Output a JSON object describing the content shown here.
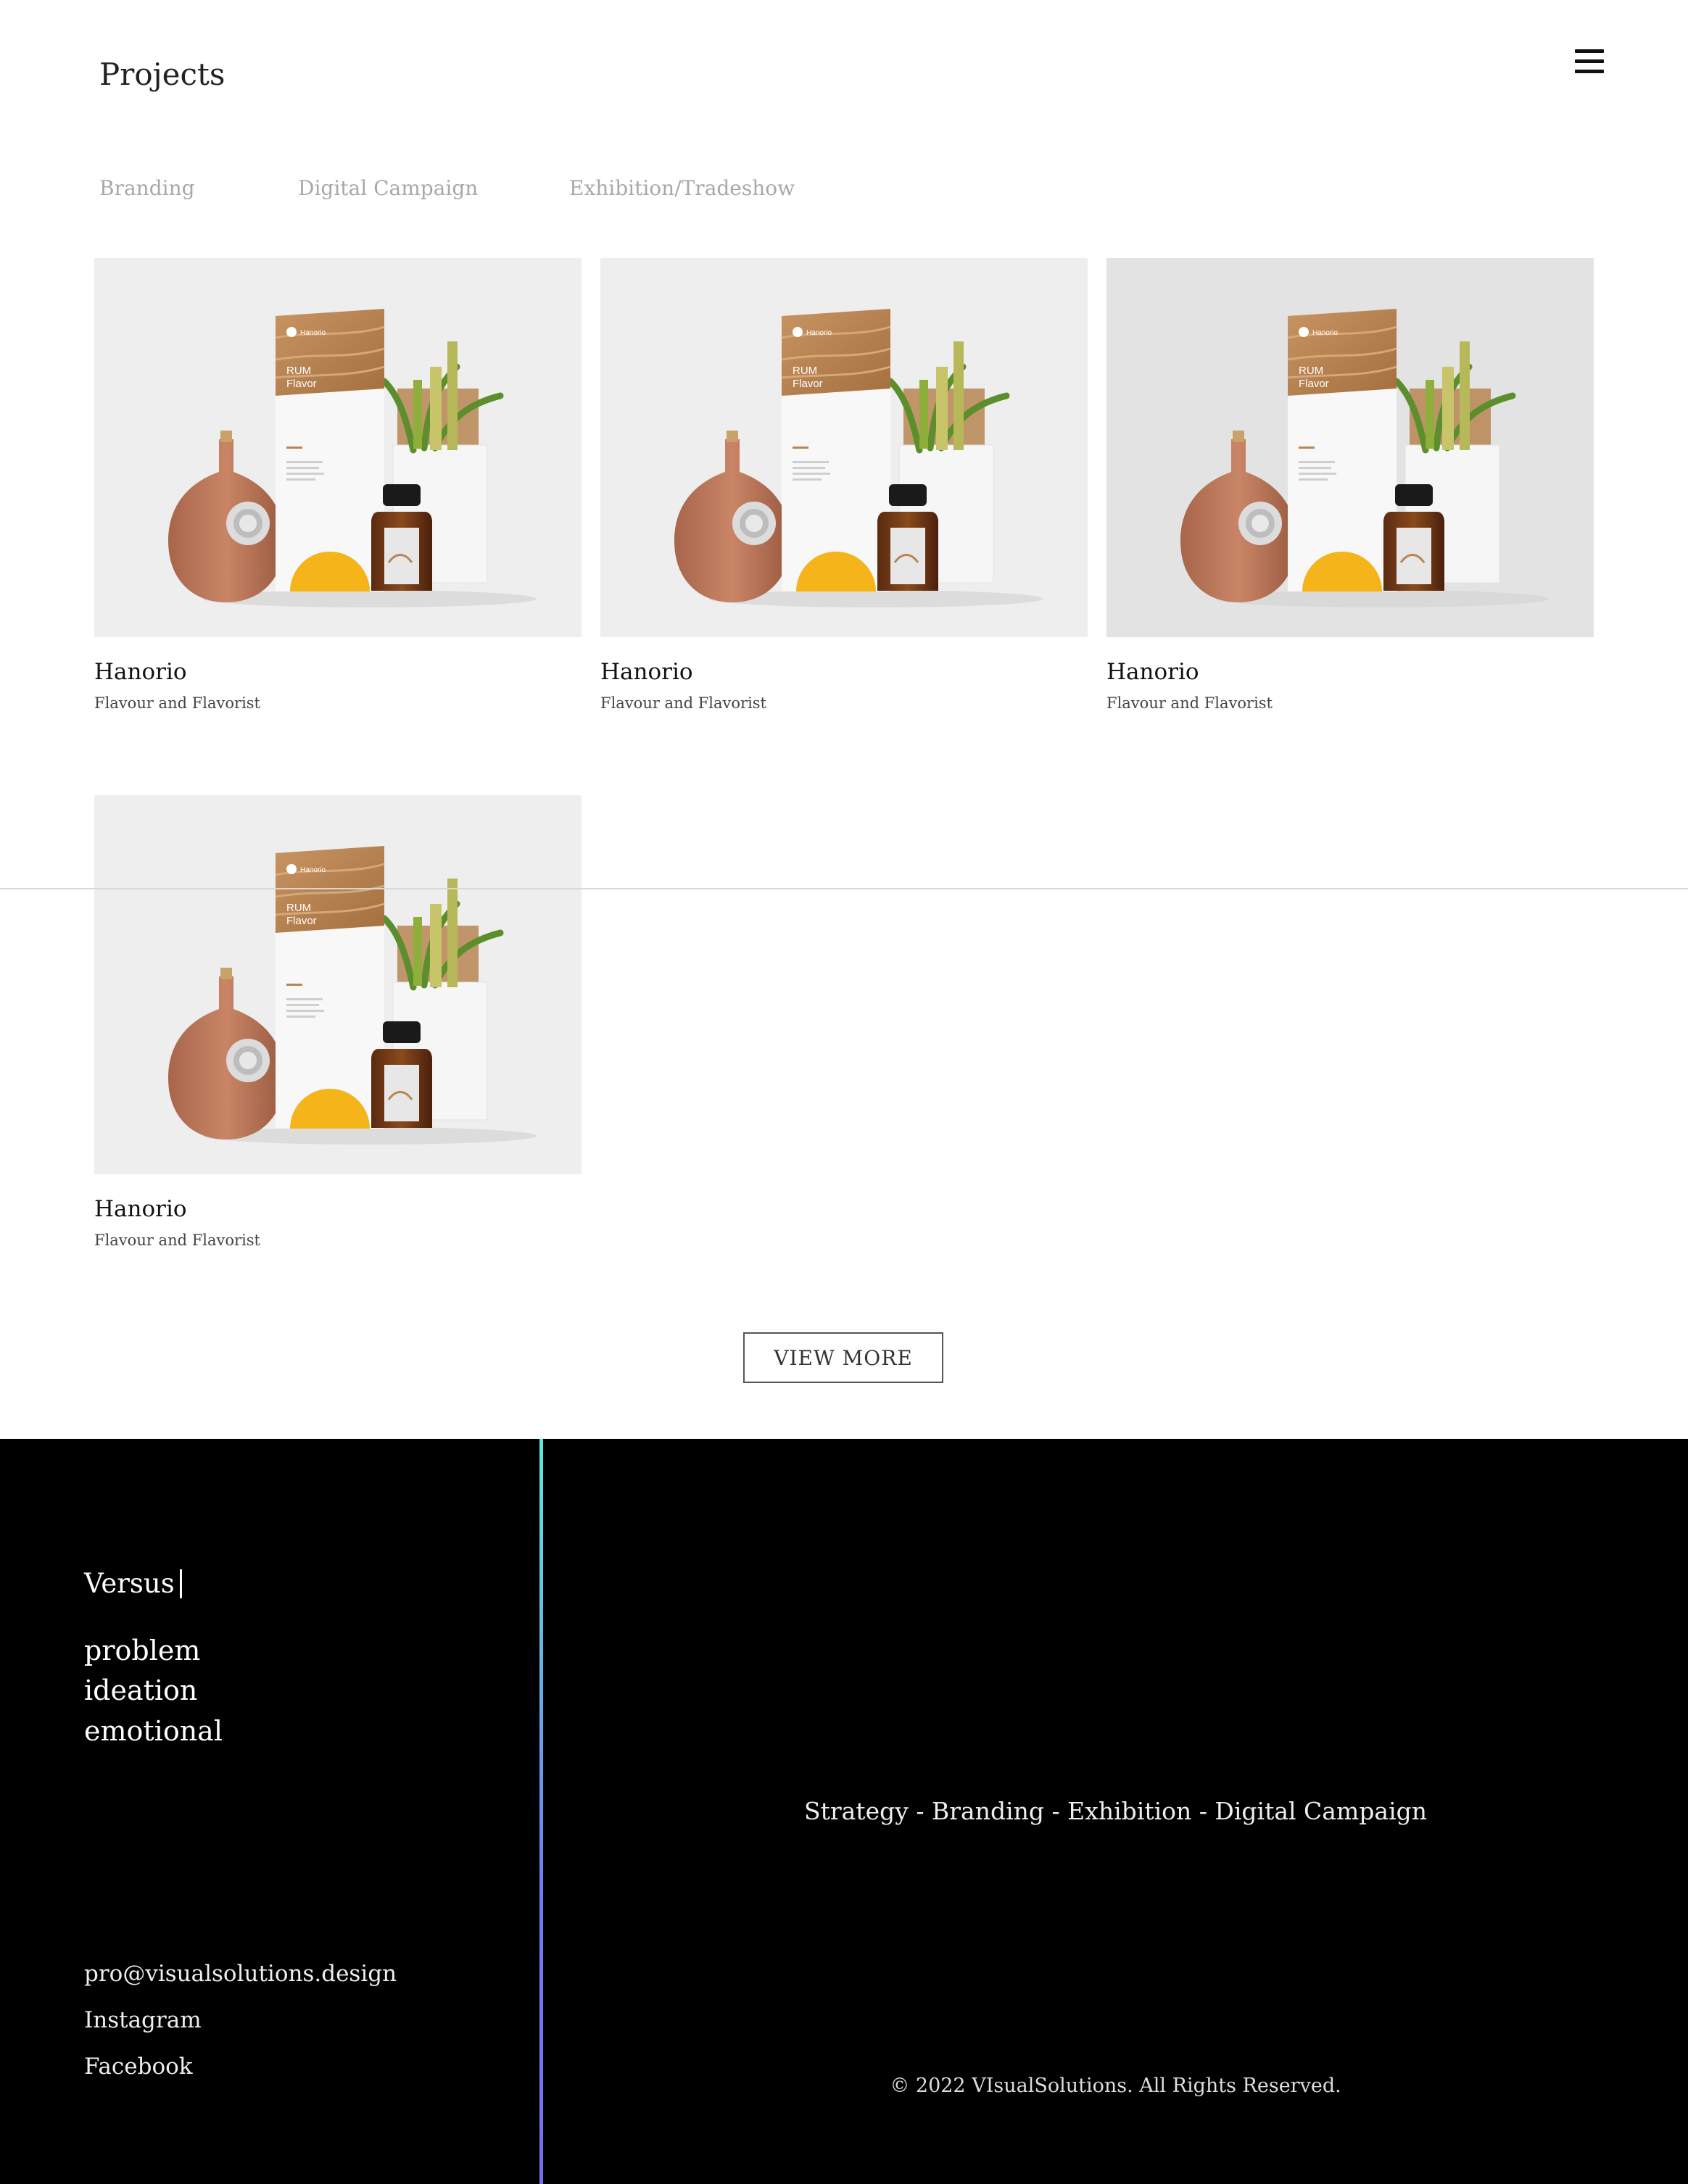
{
  "header": {
    "title": "Projects",
    "menu_icon": "hamburger-menu-icon"
  },
  "filters": [
    "Branding",
    "Digital Campaign",
    "Exhibition/Tradeshow"
  ],
  "projects": [
    {
      "title": "Hanorio",
      "subtitle": "Flavour and Flavorist",
      "image": "rum-flavor-product-mockup"
    },
    {
      "title": "Hanorio",
      "subtitle": "Flavour and Flavorist",
      "image": "rum-flavor-product-mockup"
    },
    {
      "title": "Hanorio",
      "subtitle": "Flavour and Flavorist",
      "image": "rum-flavor-product-mockup"
    },
    {
      "title": "Hanorio",
      "subtitle": "Flavour and Flavorist",
      "image": "rum-flavor-product-mockup"
    }
  ],
  "mockup_text": {
    "brand": "Hanorio",
    "line1": "RUM",
    "line2": "Flavor"
  },
  "view_more_label": "VIEW MORE",
  "footer": {
    "brand": "Versus",
    "words": [
      "problem",
      "ideation",
      "emotional"
    ],
    "links": [
      "pro@visualsolutions.design",
      "Instagram",
      "Facebook"
    ],
    "services": "Strategy - Branding - Exhibition - Digital Campaign",
    "copyright": "© 2022 VIsualSolutions. All Rights Reserved."
  },
  "colors": {
    "accent_top": "#5fe8e0",
    "accent_bottom": "#7a6ee8",
    "mockup_yellow": "#f4b41a",
    "mockup_wood": "#b98552"
  }
}
